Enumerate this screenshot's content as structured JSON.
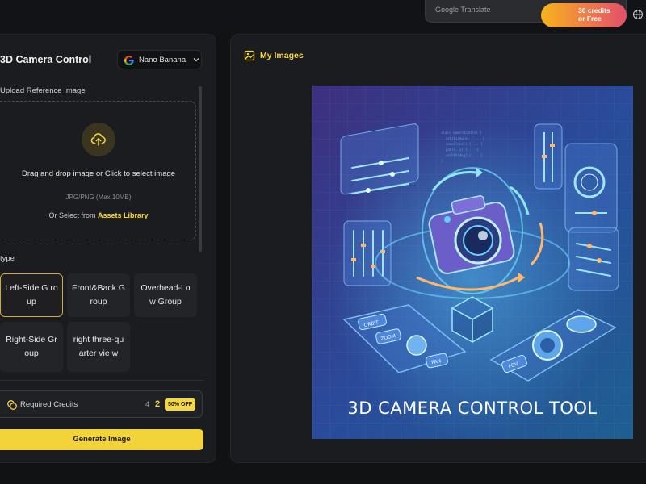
{
  "google_translate": {
    "label": "Google Translate"
  },
  "promo": {
    "line1": "30 credits",
    "line2": "or Free"
  },
  "left_panel": {
    "title": "3D Camera Control",
    "model_select": {
      "value": "Nano Banana"
    },
    "upload": {
      "label": "Upload Reference Image",
      "drop_text": "Drag and drop image or Click to select image",
      "hint": "JPG/PNG (Max 10MB)",
      "or_select": "Or Select from",
      "assets_link": "Assets Library"
    },
    "type": {
      "label": "type",
      "options": [
        {
          "label": "Left-Side G roup",
          "selected": true
        },
        {
          "label": "Front&Back Group",
          "selected": false
        },
        {
          "label": "Overhead-Low Group",
          "selected": false
        },
        {
          "label": "Right-Side Group",
          "selected": false
        },
        {
          "label": "right three-quarter vie w",
          "selected": false
        }
      ]
    },
    "credits": {
      "label": "Required Credits",
      "old_value": "4",
      "new_value": "2",
      "discount": "50% OFF"
    },
    "generate_button": "Generate Image"
  },
  "right_panel": {
    "title": "My Images",
    "preview_title": "3D CAMERA CONTROL TOOL",
    "preview_labels": {
      "orbit": "ORBIT",
      "zoom": "ZOOM",
      "pan": "PAN",
      "fov": "FOV"
    }
  },
  "colors": {
    "accent": "#f5d743",
    "panel": "#1b1c1f",
    "background": "#111214",
    "selected_border": "#d8a93a"
  }
}
